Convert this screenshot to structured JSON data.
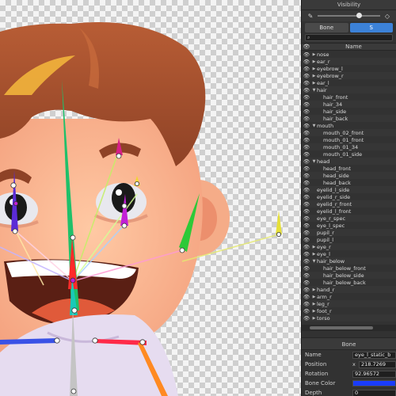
{
  "visibility_panel": {
    "title": "Visibility",
    "tabs": [
      {
        "label": "Bone",
        "active": false
      },
      {
        "label": "S",
        "active": true
      }
    ],
    "search": {
      "placeholder": ""
    },
    "name_header": "Name",
    "bones": [
      {
        "name": "nose",
        "expander": "▶",
        "level": 0
      },
      {
        "name": "ear_r",
        "expander": "▶",
        "level": 0
      },
      {
        "name": "eyebrow_l",
        "expander": "▶",
        "level": 0
      },
      {
        "name": "eyebrow_r",
        "expander": "▶",
        "level": 0
      },
      {
        "name": "ear_l",
        "expander": "▶",
        "level": 0
      },
      {
        "name": "hair",
        "expander": "▼",
        "level": 0
      },
      {
        "name": "hair_front",
        "expander": "",
        "level": 1
      },
      {
        "name": "hair_34",
        "expander": "",
        "level": 1
      },
      {
        "name": "hair_side",
        "expander": "",
        "level": 1
      },
      {
        "name": "hair_back",
        "expander": "",
        "level": 1
      },
      {
        "name": "mouth",
        "expander": "▼",
        "level": 0
      },
      {
        "name": "mouth_02_front",
        "expander": "",
        "level": 1
      },
      {
        "name": "mouth_01_front",
        "expander": "",
        "level": 1
      },
      {
        "name": "mouth_01_34",
        "expander": "",
        "level": 1
      },
      {
        "name": "mouth_01_side",
        "expander": "",
        "level": 1
      },
      {
        "name": "head",
        "expander": "▼",
        "level": 0
      },
      {
        "name": "head_front",
        "expander": "",
        "level": 1
      },
      {
        "name": "head_side",
        "expander": "",
        "level": 1
      },
      {
        "name": "head_back",
        "expander": "",
        "level": 1
      },
      {
        "name": "eyelid_l_side",
        "expander": "",
        "level": 0
      },
      {
        "name": "eyelid_r_side",
        "expander": "",
        "level": 0
      },
      {
        "name": "eyelid_r_front",
        "expander": "",
        "level": 0
      },
      {
        "name": "eyelid_l_front",
        "expander": "",
        "level": 0
      },
      {
        "name": "eye_r_spec",
        "expander": "",
        "level": 0
      },
      {
        "name": "eye_l_spec",
        "expander": "",
        "level": 0
      },
      {
        "name": "pupil_r",
        "expander": "",
        "level": 0
      },
      {
        "name": "pupil_l",
        "expander": "",
        "level": 0
      },
      {
        "name": "eye_r",
        "expander": "▶",
        "level": 0
      },
      {
        "name": "eye_l",
        "expander": "▶",
        "level": 0
      },
      {
        "name": "hair_below",
        "expander": "▼",
        "level": 0
      },
      {
        "name": "hair_below_front",
        "expander": "",
        "level": 1
      },
      {
        "name": "hair_below_side",
        "expander": "",
        "level": 1
      },
      {
        "name": "hair_below_back",
        "expander": "",
        "level": 1
      },
      {
        "name": "hand_r",
        "expander": "▶",
        "level": 0
      },
      {
        "name": "arm_r",
        "expander": "▶",
        "level": 0
      },
      {
        "name": "leg_r",
        "expander": "▶",
        "level": 0
      },
      {
        "name": "foot_r",
        "expander": "▶",
        "level": 0
      },
      {
        "name": "torso",
        "expander": "▶",
        "level": 0
      }
    ]
  },
  "bone_panel": {
    "title": "Bone",
    "name_label": "Name",
    "name_value": "eye_l_static_b",
    "position_label": "Position",
    "position_axis": "x",
    "position_x": "218.7269",
    "rotation_label": "Rotation",
    "rotation_value": "92.96572",
    "color_label": "Bone Color",
    "bone_color": "#1a3cff",
    "depth_label": "Depth",
    "depth_value": "0"
  },
  "icons": {
    "visibility": "eye-icon",
    "brush": "brush-icon",
    "eraser": "eraser-icon",
    "search": "search-icon"
  }
}
